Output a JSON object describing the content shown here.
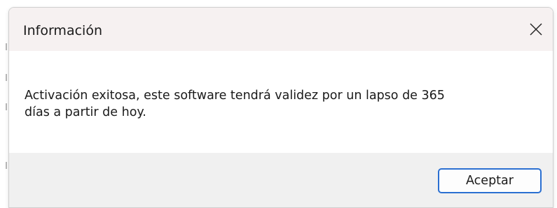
{
  "dialog": {
    "title": "Información",
    "close_icon": "close-icon",
    "message_line1": "Activación exitosa, este software tendrá validez por un lapso de 365",
    "message_line2": "días a partir de hoy.",
    "ok_label": "Aceptar"
  },
  "colors": {
    "titlebar_bg": "#f6f1f1",
    "footer_bg": "#f0f0f0",
    "button_border": "#2a6fd1"
  }
}
